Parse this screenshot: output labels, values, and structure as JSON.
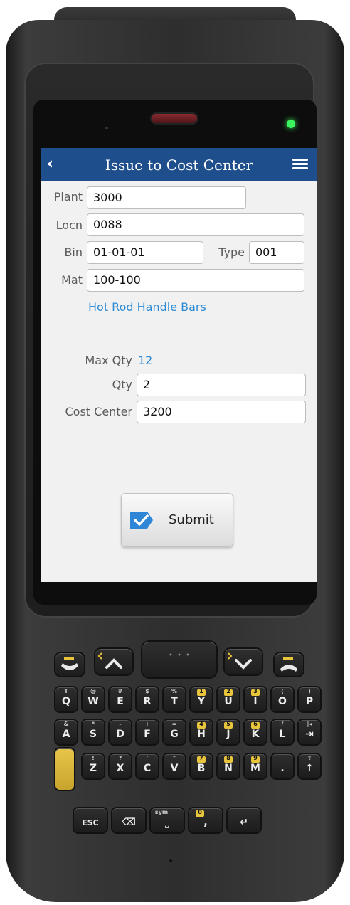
{
  "header": {
    "back_glyph": "‹",
    "title": "Issue to Cost Center"
  },
  "form": {
    "plant_label": "Plant",
    "plant_value": "3000",
    "locn_label": "Locn",
    "locn_value": "0088",
    "bin_label": "Bin",
    "bin_value": "01-01-01",
    "type_label": "Type",
    "type_value": "001",
    "mat_label": "Mat",
    "mat_value": "100-100",
    "material_description": "Hot Rod Handle Bars",
    "max_qty_label": "Max Qty",
    "max_qty_value": "12",
    "qty_label": "Qty",
    "qty_value": "2",
    "cost_center_label": "Cost Center",
    "cost_center_value": "3200"
  },
  "submit": {
    "label": "Submit",
    "icon": "checkmark-icon"
  },
  "colors": {
    "header": "#1f4e8c",
    "link": "#2b8ad6",
    "led": "#3cf35f",
    "accent_key": "#e6c64a"
  },
  "keypad": {
    "row1": [
      {
        "main": "Q",
        "sub": "T"
      },
      {
        "main": "W",
        "sub": "@"
      },
      {
        "main": "E",
        "sub": "#"
      },
      {
        "main": "R",
        "sub": "$"
      },
      {
        "main": "T",
        "sub": "%"
      },
      {
        "main": "Y",
        "sub": "1",
        "yellow": true
      },
      {
        "main": "U",
        "sub": "2",
        "yellow": true
      },
      {
        "main": "I",
        "sub": "3",
        "yellow": true
      },
      {
        "main": "O",
        "sub": "("
      },
      {
        "main": "P",
        "sub": ")"
      }
    ],
    "row2": [
      {
        "main": "A",
        "sub": "&"
      },
      {
        "main": "S",
        "sub": "*"
      },
      {
        "main": "D",
        "sub": "-"
      },
      {
        "main": "F",
        "sub": "+"
      },
      {
        "main": "G",
        "sub": "="
      },
      {
        "main": "H",
        "sub": "4",
        "yellow": true
      },
      {
        "main": "J",
        "sub": "5",
        "yellow": true
      },
      {
        "main": "K",
        "sub": "6",
        "yellow": true
      },
      {
        "main": "L",
        "sub": "/"
      },
      {
        "main": "⇥",
        "sub": "|◂"
      }
    ],
    "row3": [
      {
        "main": "Z",
        "sub": "!"
      },
      {
        "main": "X",
        "sub": "?"
      },
      {
        "main": "C",
        "sub": "'"
      },
      {
        "main": "V",
        "sub": "\""
      },
      {
        "main": "B",
        "sub": "7",
        "yellow": true
      },
      {
        "main": "N",
        "sub": "8",
        "yellow": true
      },
      {
        "main": "M",
        "sub": "9",
        "yellow": true
      },
      {
        "main": ".",
        "sub": ""
      },
      {
        "main": "↑",
        "sub": "⇧"
      }
    ],
    "row4": [
      {
        "main": "ESC",
        "sub": ""
      },
      {
        "main": "⌫",
        "sub": ""
      },
      {
        "main": "⎵",
        "sub": "sym"
      },
      {
        "main": ",",
        "sub": "0",
        "yellow": true
      },
      {
        "main": "↵",
        "sub": ""
      }
    ]
  }
}
